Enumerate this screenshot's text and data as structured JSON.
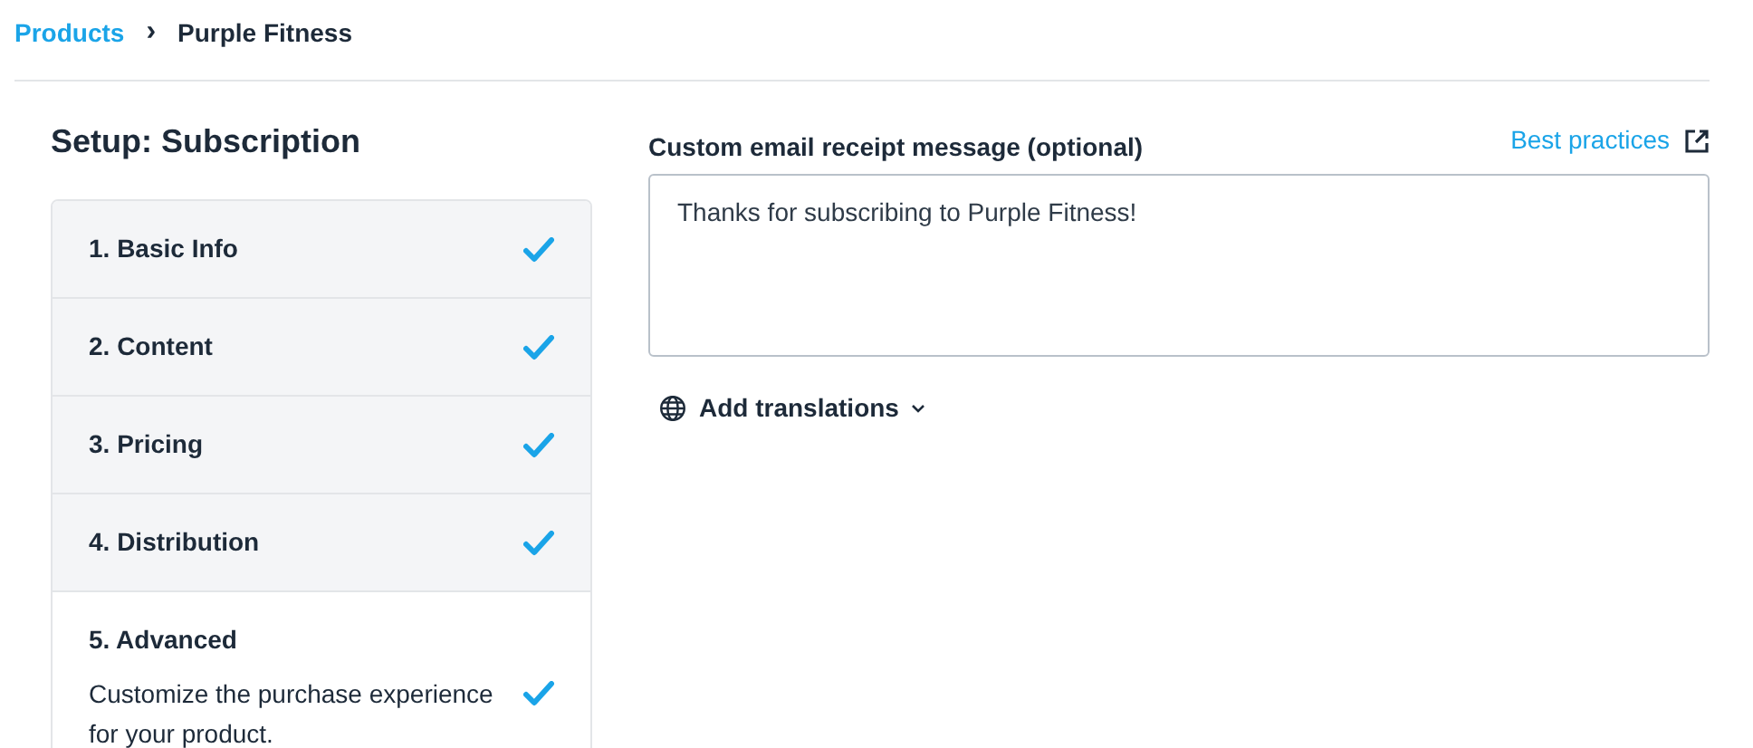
{
  "breadcrumb": [
    {
      "label": "Products",
      "kind": "link"
    },
    {
      "label": "›",
      "kind": "separator"
    },
    {
      "label": "Purple Fitness",
      "kind": "current"
    }
  ],
  "setup": {
    "title": "Setup: Subscription",
    "steps": [
      {
        "label": "1. Basic Info",
        "checked": true
      },
      {
        "label": "2. Content",
        "checked": true
      },
      {
        "label": "3. Pricing",
        "checked": true
      },
      {
        "label": "4. Distribution",
        "checked": true
      },
      {
        "label": "5. Advanced",
        "description": "Customize the purchase experience for your product.",
        "checked": true
      }
    ]
  },
  "receipt": {
    "label": "Custom email receipt message (optional)",
    "help_link": "Best practices",
    "value": "Thanks for subscribing to Purple Fitness!",
    "translations_button": "Add translations"
  }
}
